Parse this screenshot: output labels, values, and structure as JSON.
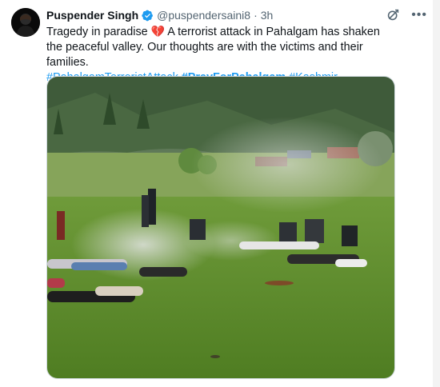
{
  "author": {
    "name": "Puspender Singh",
    "handle": "@puspendersaini8",
    "separator": "·",
    "time": "3h"
  },
  "tweet": {
    "text_before_emoji": "Tragedy in paradise ",
    "emoji": "💔",
    "text_after_emoji": " A terrorist attack in Pahalgam has shaken the peaceful valley. Our thoughts are with the victims and their families.",
    "hashtags": [
      "#PahalgamTerroristAttack",
      "#PrayForPahalgam",
      "#Kashmir"
    ]
  },
  "icons": {
    "verified": "verified-badge-icon",
    "grok": "grok-icon",
    "more": "more-icon",
    "heart": "broken-heart-icon"
  },
  "colors": {
    "link": "#1d9bf0",
    "secondary_text": "#536471",
    "verified_blue": "#1d9bf0"
  }
}
